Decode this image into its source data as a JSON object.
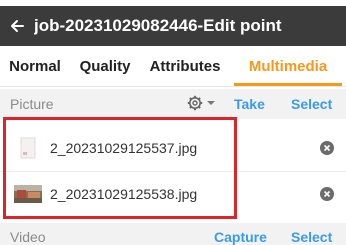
{
  "header": {
    "title": "job-20231029082446-Edit point"
  },
  "tabs": [
    {
      "label": "Normal",
      "active": false
    },
    {
      "label": "Quality",
      "active": false
    },
    {
      "label": "Attributes",
      "active": false
    },
    {
      "label": "Multimedia",
      "active": true
    }
  ],
  "picture": {
    "title": "Picture",
    "take_label": "Take",
    "select_label": "Select",
    "files": [
      {
        "name": "2_20231029125537.jpg",
        "thumb": "blank-thumbnail-icon"
      },
      {
        "name": "2_20231029125538.jpg",
        "thumb": "photo-thumbnail-icon"
      }
    ]
  },
  "video": {
    "title": "Video",
    "capture_label": "Capture",
    "select_label": "Select"
  },
  "colors": {
    "title_bar": "#3b3b3b",
    "accent_active_tab": "#f39a1e",
    "action_blue": "#3a9ce8",
    "highlight_red": "#d9262c"
  }
}
